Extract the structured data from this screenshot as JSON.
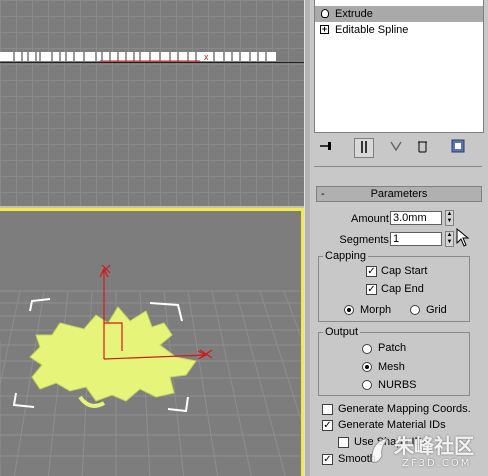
{
  "modifier_stack": {
    "items": [
      {
        "label": "Extrude",
        "icon": "lightbulb-icon",
        "selected": true
      },
      {
        "label": "Editable Spline",
        "icon": "plus-expander-icon",
        "selected": false
      }
    ]
  },
  "toolbar": {
    "icons": [
      "pin-stack-icon",
      "show-end-result-icon",
      "make-unique-icon",
      "remove-modifier-icon",
      "configure-sets-icon"
    ]
  },
  "parameters": {
    "title": "Parameters",
    "collapse_symbol": "-",
    "amount_label": "Amount:",
    "amount_value": "3.0mm",
    "segments_label": "Segments:",
    "segments_value": "1",
    "capping": {
      "title": "Capping",
      "cap_start": "Cap Start",
      "cap_start_checked": true,
      "cap_end": "Cap End",
      "cap_end_checked": true,
      "morph": "Morph",
      "grid": "Grid",
      "selected": "Morph"
    },
    "output": {
      "title": "Output",
      "patch": "Patch",
      "mesh": "Mesh",
      "nurbs": "NURBS",
      "selected": "Mesh"
    },
    "generate_mapping": "Generate Mapping Coords.",
    "generate_mapping_checked": false,
    "generate_material_ids": "Generate Material IDs",
    "generate_material_ids_checked": true,
    "use_shape_ids": "Use Shape IDs",
    "use_shape_ids_checked": false,
    "smooth": "Smooth",
    "smooth_checked": true
  },
  "viewport_marker": "x",
  "watermark": {
    "text": "朱峰社区",
    "sub": "ZF3D.COM"
  },
  "colors": {
    "viewport_active_border": "#f2e94a",
    "shape_fill": "#e6f57a",
    "gizmo_red": "#d21a1a"
  }
}
